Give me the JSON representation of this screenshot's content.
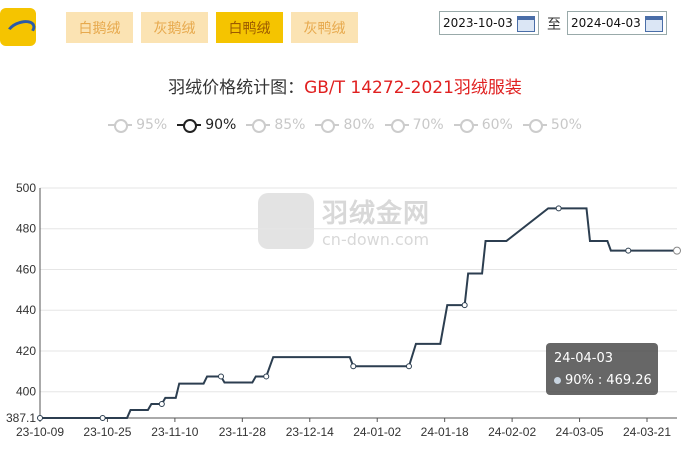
{
  "header": {
    "tabs": [
      {
        "label": "白鹅绒",
        "active": false
      },
      {
        "label": "灰鹅绒",
        "active": false
      },
      {
        "label": "白鸭绒",
        "active": true
      },
      {
        "label": "灰鸭绒",
        "active": false
      }
    ],
    "date_from": "2023-10-03",
    "date_to": "2024-04-03",
    "to_label": "至"
  },
  "title_prefix": "羽绒价格统计图：",
  "title_standard": "GB/T 14272-2021羽绒服装",
  "legend": [
    {
      "label": "95%",
      "active": false
    },
    {
      "label": "90%",
      "active": true
    },
    {
      "label": "85%",
      "active": false
    },
    {
      "label": "80%",
      "active": false
    },
    {
      "label": "70%",
      "active": false
    },
    {
      "label": "60%",
      "active": false
    },
    {
      "label": "50%",
      "active": false
    }
  ],
  "watermark": {
    "name": "羽绒金网",
    "url": "cn-down.com"
  },
  "tooltip": {
    "date": "24-04-03",
    "series": "90%",
    "value": "469.26"
  },
  "colors": {
    "line": "#2c3e50",
    "active_tab": "#f5c400",
    "inactive_tab": "#fbe3b3",
    "title_accent": "#e02020"
  },
  "chart_data": {
    "type": "line",
    "x_ticks": [
      "23-10-09",
      "23-10-25",
      "23-11-10",
      "23-11-28",
      "23-12-14",
      "24-01-02",
      "24-01-18",
      "24-02-02",
      "24-03-05",
      "24-03-21"
    ],
    "y_ticks": [
      387.1,
      400,
      420,
      440,
      460,
      480,
      500
    ],
    "ylim": [
      387.1,
      500
    ],
    "xlim": [
      "2023-10-03",
      "2024-04-03"
    ],
    "series": [
      {
        "name": "90%",
        "points": [
          [
            "2023-10-03",
            387.1
          ],
          [
            "2023-10-21",
            387.1
          ],
          [
            "2023-10-28",
            387.1
          ],
          [
            "2023-10-29",
            391
          ],
          [
            "2023-11-03",
            391
          ],
          [
            "2023-11-04",
            394
          ],
          [
            "2023-11-07",
            394
          ],
          [
            "2023-11-08",
            397
          ],
          [
            "2023-11-11",
            397
          ],
          [
            "2023-11-12",
            404
          ],
          [
            "2023-11-19",
            404
          ],
          [
            "2023-11-20",
            407.5
          ],
          [
            "2023-11-24",
            407.5
          ],
          [
            "2023-11-25",
            404.5
          ],
          [
            "2023-12-03",
            404.5
          ],
          [
            "2023-12-04",
            407.5
          ],
          [
            "2023-12-07",
            407.5
          ],
          [
            "2023-12-09",
            417
          ],
          [
            "2023-12-31",
            417
          ],
          [
            "2024-01-01",
            412.5
          ],
          [
            "2024-01-17",
            412.5
          ],
          [
            "2024-01-19",
            423.5
          ],
          [
            "2024-01-26",
            423.5
          ],
          [
            "2024-01-28",
            442.5
          ],
          [
            "2024-02-02",
            442.5
          ],
          [
            "2024-02-03",
            458
          ],
          [
            "2024-02-07",
            458
          ],
          [
            "2024-02-08",
            474
          ],
          [
            "2024-02-14",
            474
          ],
          [
            "2024-02-26",
            490
          ],
          [
            "2024-03-08",
            490
          ],
          [
            "2024-03-09",
            474
          ],
          [
            "2024-03-14",
            474
          ],
          [
            "2024-03-15",
            469.26
          ],
          [
            "2024-04-03",
            469.26
          ]
        ],
        "markers": [
          "2023-10-03",
          "2023-10-21",
          "2023-11-07",
          "2023-11-24",
          "2023-12-07",
          "2024-01-01",
          "2024-01-17",
          "2024-02-02",
          "2024-02-29",
          "2024-03-20",
          "2024-04-03"
        ]
      }
    ]
  }
}
